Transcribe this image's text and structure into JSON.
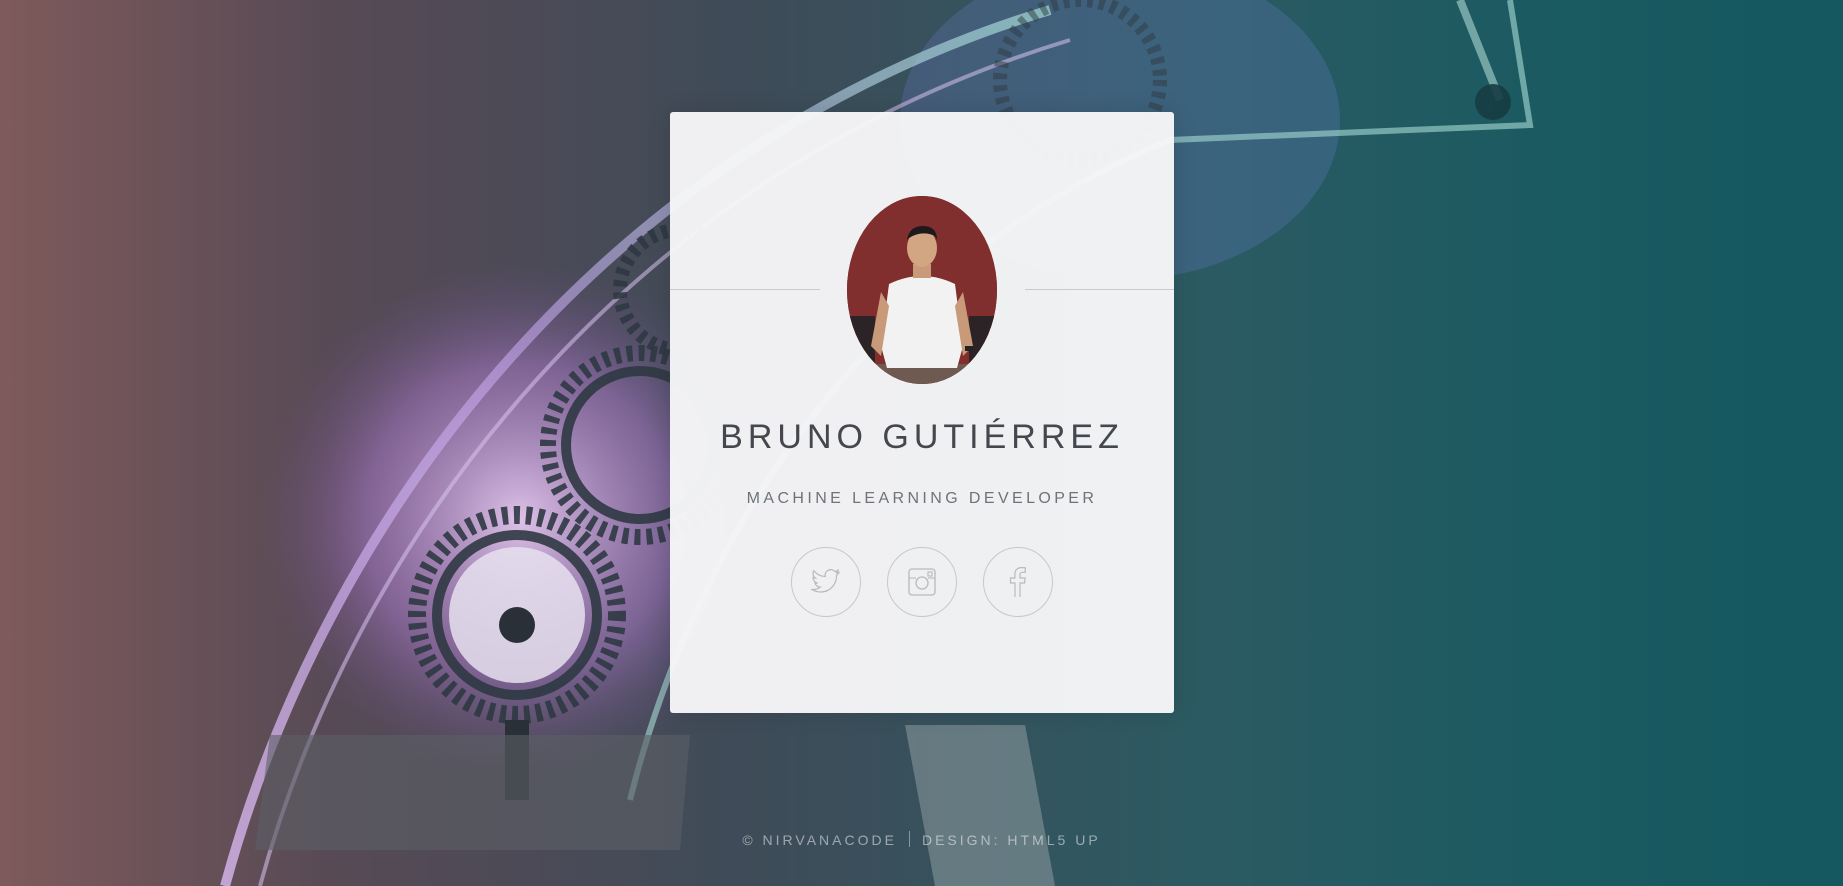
{
  "profile": {
    "name": "BRUNO GUTIÉRREZ",
    "role": "MACHINE LEARNING DEVELOPER",
    "avatar_alt": "profile-photo"
  },
  "social_links": [
    {
      "icon": "twitter-icon"
    },
    {
      "icon": "instagram-icon"
    },
    {
      "icon": "facebook-icon"
    }
  ],
  "footer": {
    "copyright": "© NIRVANACODE",
    "design_label": "DESIGN:",
    "design_link": "HTML5 UP"
  },
  "colors": {
    "card": "#f6f6f7",
    "title": "#44484e",
    "subtitle": "#6e737a",
    "icon_stroke": "#b8babe"
  }
}
